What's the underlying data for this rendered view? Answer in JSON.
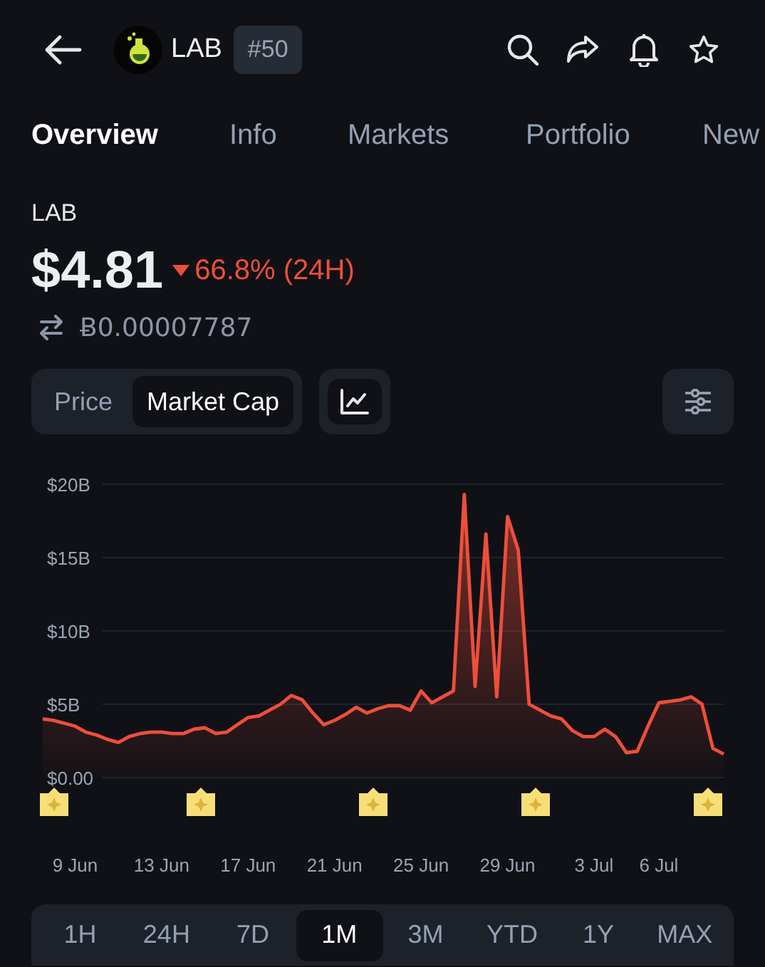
{
  "header": {
    "symbol": "LAB",
    "rank": "#50"
  },
  "tabs": [
    {
      "label": "Overview",
      "selected": true
    },
    {
      "label": "Info",
      "selected": false
    },
    {
      "label": "Markets",
      "selected": false
    },
    {
      "label": "Portfolio",
      "selected": false
    },
    {
      "label": "New",
      "selected": false
    }
  ],
  "coin": {
    "name": "LAB",
    "price": "$4.81",
    "change": "66.8% (24H)",
    "falling": true,
    "btc_price": "Ƀ0.00007787"
  },
  "chart_modes": [
    {
      "label": "Price",
      "selected": false
    },
    {
      "label": "Market Cap",
      "selected": true
    }
  ],
  "chart": {
    "chart_data": {
      "type": "area",
      "grid": true,
      "ylim": [
        0,
        20
      ],
      "yticks": [
        {
          "value": 0,
          "label": "$0.00"
        },
        {
          "value": 5,
          "label": "$5B"
        },
        {
          "value": 10,
          "label": "$10B"
        },
        {
          "value": 15,
          "label": "$15B"
        },
        {
          "value": 20,
          "label": "$20B"
        }
      ],
      "categories": [
        null,
        null,
        null,
        "9 Jun",
        null,
        null,
        null,
        null,
        null,
        null,
        null,
        "13 Jun",
        null,
        null,
        null,
        null,
        null,
        null,
        null,
        "17 Jun",
        null,
        null,
        null,
        null,
        null,
        null,
        null,
        "21 Jun",
        null,
        null,
        null,
        null,
        null,
        null,
        null,
        "25 Jun",
        null,
        null,
        null,
        null,
        null,
        null,
        null,
        "29 Jun",
        null,
        null,
        null,
        null,
        null,
        null,
        null,
        "3 Jul",
        null,
        null,
        null,
        null,
        null,
        "6 Jul",
        null,
        null,
        null,
        null,
        null,
        null
      ],
      "series": [
        {
          "color": "#ef4e3a",
          "values": [
            4.0,
            3.9,
            3.7,
            3.5,
            3.1,
            2.9,
            2.6,
            2.4,
            2.8,
            3.0,
            3.1,
            3.1,
            3.0,
            3.0,
            3.3,
            3.4,
            3.0,
            3.1,
            3.6,
            4.1,
            4.2,
            4.6,
            5.0,
            5.6,
            5.3,
            4.4,
            3.6,
            3.9,
            4.3,
            4.8,
            4.4,
            4.7,
            4.9,
            4.9,
            4.6,
            5.9,
            5.1,
            5.5,
            5.9,
            19.3,
            6.2,
            16.6,
            5.5,
            17.8,
            15.5,
            5.0,
            4.6,
            4.2,
            4.0,
            3.2,
            2.8,
            2.8,
            3.3,
            2.8,
            1.7,
            1.8,
            3.5,
            5.1,
            5.2,
            5.3,
            5.5,
            5.0,
            2.0,
            1.6
          ]
        }
      ]
    }
  },
  "periods": [
    {
      "label": "1H",
      "selected": false
    },
    {
      "label": "24H",
      "selected": false
    },
    {
      "label": "7D",
      "selected": false
    },
    {
      "label": "1M",
      "selected": true
    },
    {
      "label": "3M",
      "selected": false
    },
    {
      "label": "YTD",
      "selected": false
    },
    {
      "label": "1Y",
      "selected": false
    },
    {
      "label": "MAX",
      "selected": false
    }
  ]
}
